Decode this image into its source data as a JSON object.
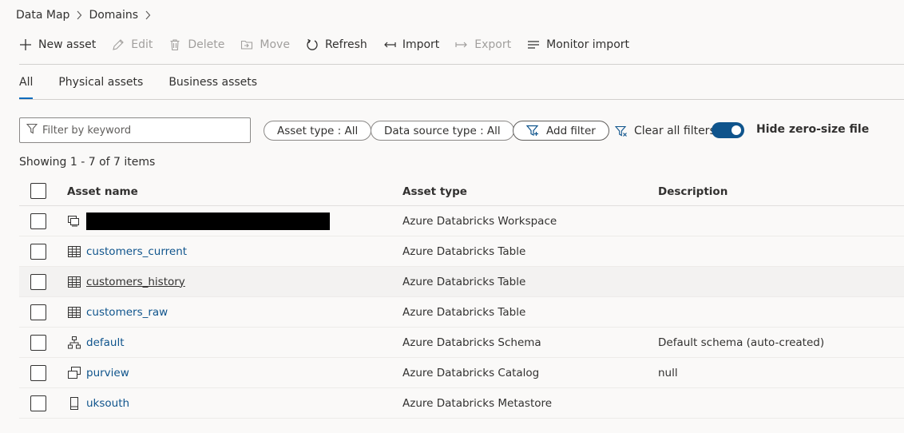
{
  "breadcrumb": {
    "items": [
      "Data Map",
      "Domains"
    ]
  },
  "toolbar": {
    "new_asset": "New asset",
    "edit": "Edit",
    "delete": "Delete",
    "move": "Move",
    "refresh": "Refresh",
    "import": "Import",
    "export": "Export",
    "monitor_import": "Monitor import"
  },
  "tabs": [
    {
      "label": "All",
      "active": true
    },
    {
      "label": "Physical assets",
      "active": false
    },
    {
      "label": "Business assets",
      "active": false
    }
  ],
  "filters": {
    "keyword_placeholder": "Filter by keyword",
    "asset_type": "Asset type : All",
    "data_source_type": "Data source type : All",
    "add_filter": "Add filter",
    "clear_all": "Clear all filters",
    "hide_zero_size_label": "Hide zero-size file",
    "hide_zero_size_on": true
  },
  "showing": "Showing 1 - 7 of 7 items",
  "table": {
    "columns": [
      "Asset name",
      "Asset type",
      "Description"
    ],
    "rows": [
      {
        "name": "",
        "redacted": true,
        "icon": "workspace-icon",
        "type": "Azure Databricks Workspace",
        "description": ""
      },
      {
        "name": "customers_current",
        "icon": "table-icon",
        "type": "Azure Databricks Table",
        "description": ""
      },
      {
        "name": "customers_history",
        "icon": "table-icon",
        "type": "Azure Databricks Table",
        "description": "",
        "hovered": true
      },
      {
        "name": "customers_raw",
        "icon": "table-icon",
        "type": "Azure Databricks Table",
        "description": ""
      },
      {
        "name": "default",
        "icon": "schema-icon",
        "type": "Azure Databricks Schema",
        "description": "Default schema (auto-created)"
      },
      {
        "name": "purview",
        "icon": "catalog-icon",
        "type": "Azure Databricks Catalog",
        "description": "null"
      },
      {
        "name": "uksouth",
        "icon": "metastore-icon",
        "type": "Azure Databricks Metastore",
        "description": ""
      }
    ]
  },
  "colors": {
    "accent": "#0f6cbd",
    "link": "#0f548c",
    "toggle_on": "#0f548c"
  }
}
